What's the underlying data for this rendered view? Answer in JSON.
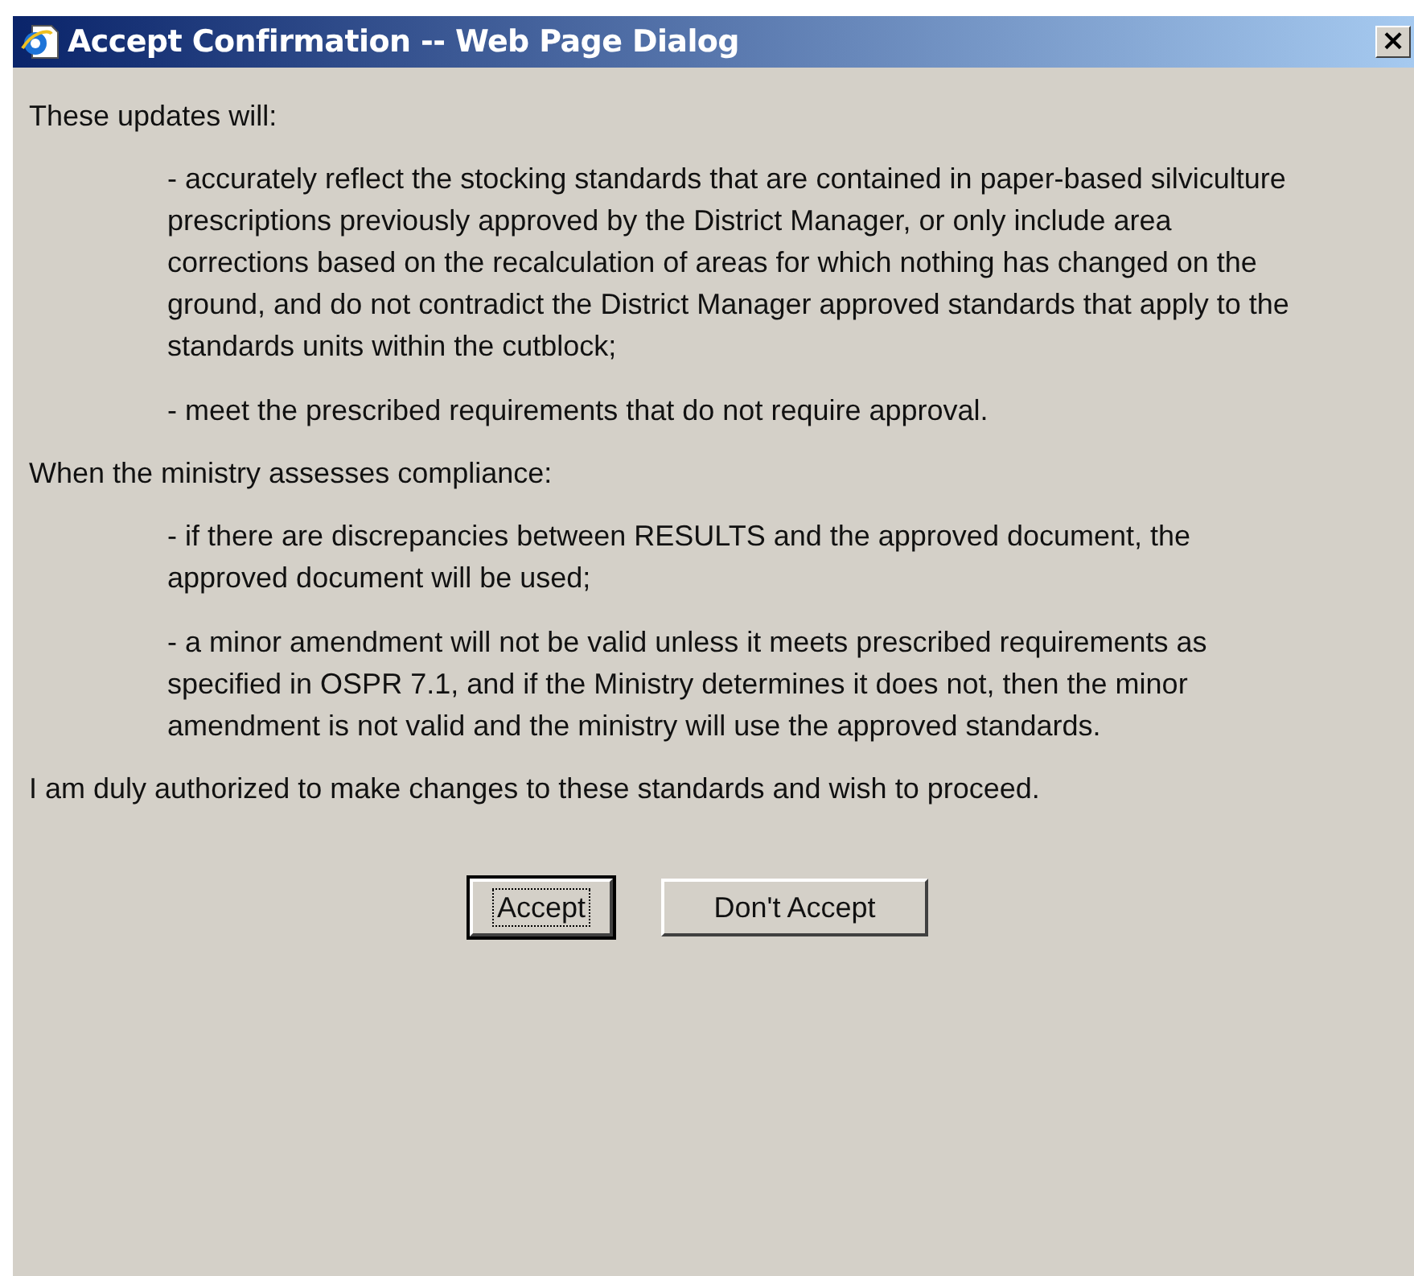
{
  "window": {
    "title": "Accept Confirmation -- Web Page Dialog",
    "close_label": "×"
  },
  "sections": [
    {
      "heading": "These updates will:",
      "items": [
        "- accurately reflect the stocking standards that are contained in paper-based silviculture prescriptions previously approved by the District Manager, or only include area corrections based on the recalculation of areas for which nothing has changed on the ground, and do not contradict the District Manager approved standards that apply to the standards units within the cutblock;",
        "- meet the prescribed requirements that do not require approval."
      ]
    },
    {
      "heading": "When the ministry assesses compliance:",
      "items": [
        "- if there are discrepancies between RESULTS and the approved document, the approved document will be used;",
        "- a minor amendment will not be valid unless it meets prescribed requirements as specified in OSPR 7.1, and if the Ministry determines it does not, then the minor amendment is not valid and the ministry will use the approved standards."
      ]
    }
  ],
  "closing": "I am duly authorized to make changes to these standards and wish to proceed.",
  "buttons": [
    {
      "label": "Accept",
      "default": true
    },
    {
      "label": "Don't Accept",
      "default": false
    }
  ]
}
